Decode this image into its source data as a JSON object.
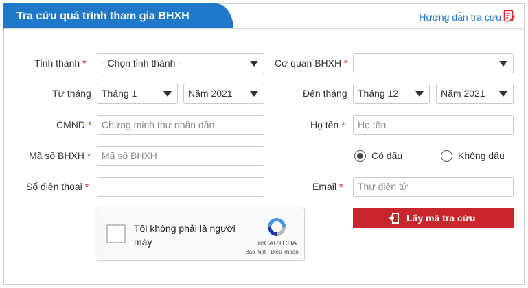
{
  "header": {
    "title": "Tra cứu quá trình tham gia BHXH",
    "guide_link": "Hướng dẫn tra cứu",
    "accent_color": "#1f78c8"
  },
  "form": {
    "province": {
      "label": "Tỉnh thành",
      "required": "*",
      "value": "- Chọn tỉnh thành -"
    },
    "agency": {
      "label": "Cơ quan BHXH",
      "required": "*",
      "value": ""
    },
    "from": {
      "label": "Từ tháng",
      "month": "Tháng 1",
      "year": "Năm 2021"
    },
    "to": {
      "label": "Đến tháng",
      "month": "Tháng 12",
      "year": "Năm 2021"
    },
    "id_card": {
      "label": "CMND",
      "required": "*",
      "placeholder": "Chứng minh thư nhân dân"
    },
    "full_name": {
      "label": "Họ tên",
      "required": "*",
      "placeholder": "Họ tên"
    },
    "insurance_code": {
      "label": "Mã số BHXH",
      "required": "*",
      "placeholder": "Mã số BHXH"
    },
    "accent_option": {
      "with_accent": "Có dấu",
      "without_accent": "Không dấu",
      "selected": "with_accent"
    },
    "phone": {
      "label": "Số điện thoại",
      "required": "*",
      "value": ""
    },
    "email": {
      "label": "Email",
      "required": "*",
      "placeholder": "Thư điện tử"
    }
  },
  "captcha": {
    "text": "Tôi không phải là người máy",
    "brand": "reCAPTCHA",
    "links": "Bảo mật - Điều khoản"
  },
  "submit": {
    "label": "Lấy mã tra cứu",
    "color": "#c9252c"
  },
  "icons": {
    "guide": "edit-document-icon",
    "submit": "exit-door-icon",
    "captcha": "recaptcha-logo-icon"
  }
}
